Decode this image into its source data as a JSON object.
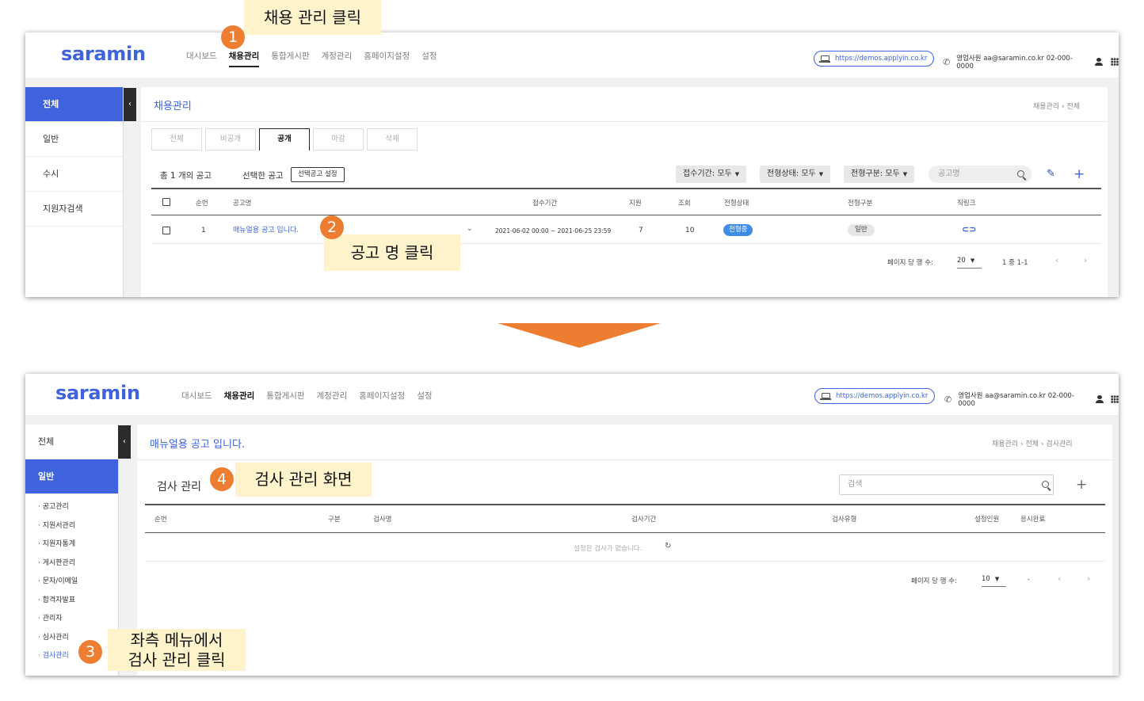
{
  "annotations": {
    "step1_number": "1",
    "step1_text": "채용 관리 클릭",
    "step2_number": "2",
    "step2_text": "공고 명 클릭",
    "step3_number": "3",
    "step3_text_line1": "좌측 메뉴에서",
    "step3_text_line2": "검사 관리 클릭",
    "step4_number": "4",
    "step4_text": "검사 관리 화면"
  },
  "colors": {
    "accent": "#3e63dd",
    "annotation_orange": "#ed7d31",
    "annotation_bg": "#fff3cc",
    "status_blue": "#3e8de8"
  },
  "header": {
    "logo": "saramin",
    "nav": [
      "대시보드",
      "채용관리",
      "통합게시판",
      "계정관리",
      "홈페이지설정",
      "설정"
    ],
    "active_nav": "채용관리",
    "site_url": "https://demos.applyin.co.kr",
    "contact": "영업사원 aa@saramin.co.kr 02-000-0000"
  },
  "screen1": {
    "sidebar": [
      "전체",
      "일반",
      "수시",
      "지원자검색"
    ],
    "collapse_glyph": "‹",
    "page_title": "채용관리",
    "breadcrumb": [
      "채용관리",
      "전체"
    ],
    "tabs": [
      "전체",
      "비공개",
      "공개",
      "마감",
      "삭제"
    ],
    "active_tab": "공개",
    "total_text": "총 1 개의 공고",
    "selected_text": "선택한 공고",
    "selected_button": "선택공고 설정",
    "filters": [
      "접수기간: 모두",
      "전형상태: 모두",
      "전형구분: 모두"
    ],
    "search_placeholder": "공고명",
    "columns": [
      "순번",
      "공고명",
      "접수기간",
      "지원",
      "조회",
      "전형상태",
      "전형구분",
      "직링크"
    ],
    "rows": [
      {
        "no": "1",
        "title": "매뉴얼용 공고 입니다.",
        "period": "2021-06-02 00:00 ~ 2021-06-25 23:59",
        "applied": "7",
        "views": "10",
        "status": "전형중",
        "type": "일반",
        "link": "⊂⊃"
      }
    ],
    "pager": {
      "rows_label": "페이지 당 행 수:",
      "rows_value": "20",
      "range": "1 중 1-1"
    }
  },
  "screen2": {
    "sidebar_top": [
      "전체",
      "일반"
    ],
    "sub_menu": [
      "· 공고관리",
      "· 지원서관리",
      "· 지원자통계",
      "· 게시판관리",
      "· 문자/이메일",
      "· 합격자발표",
      "· 관리자",
      "· 심사관리",
      "· 검사관리"
    ],
    "active_sub": "· 검사관리",
    "page_title": "매뉴얼용 공고 입니다.",
    "breadcrumb": [
      "채용관리",
      "전체",
      "검사관리"
    ],
    "section_title": "검사 관리",
    "search_placeholder": "검색",
    "columns": [
      "순번",
      "구분",
      "검사명",
      "검사기간",
      "검사유형",
      "설정인원",
      "응시완료"
    ],
    "empty_text": "설정된 검사가 없습니다.",
    "pager": {
      "rows_label": "페이지 당 행 수:",
      "rows_value": "10",
      "range": "-"
    }
  }
}
